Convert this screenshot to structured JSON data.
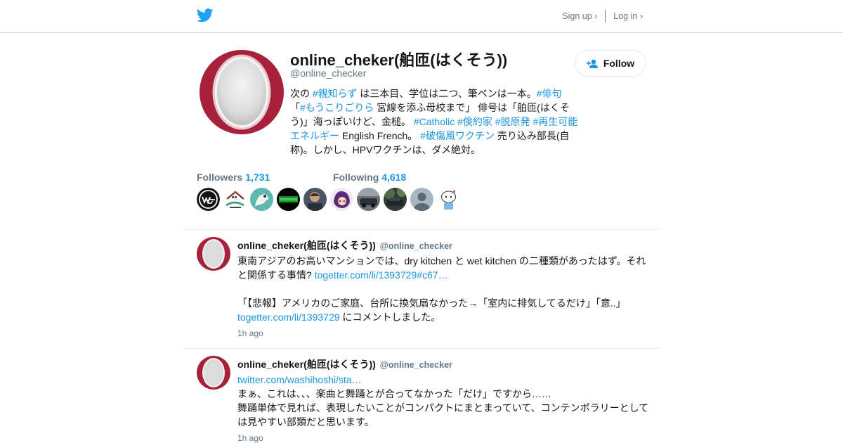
{
  "nav": {
    "signup_label": "Sign up ›",
    "login_label": "Log in ›"
  },
  "profile": {
    "name": "online_cheker(舶匝(はくそう))",
    "handle": "@online_checker",
    "follow_label": "Follow",
    "bio": {
      "s1": "次の ",
      "t1": "#親知らず",
      "s2": " は三本目、学位は二つ、筆ペンは一本。",
      "t2": "#俳句",
      "s3": "「",
      "t3": "#もうこりごりら",
      "s4": " 宮線を添ふ母校まで」 俳号は「舶匝(はくそう)」海っぽいけど、金槌。 ",
      "t4": "#Catholic",
      "s5": " ",
      "t5": "#倹約家",
      "s6": " ",
      "t6": "#脱原発",
      "s7": " ",
      "t7": "#再生可能エネルギー",
      "s8": " English French。 ",
      "t8": "#破傷風ワクチン",
      "s9": " 売り込み部長(自称)。しかし、HPVワクチンは、ダメ絶対。"
    },
    "followers_label": "Followers",
    "followers_count": "1,731",
    "following_label": "Following",
    "following_count": "4,618"
  },
  "tweets": [
    {
      "name": "online_cheker(舶匝(はくそう))",
      "handle": "@online_checker",
      "p1_text": "東南アジアのお高いマンションでは、dry kitchen と wet kitchen の二種類があったはず。それと関係する事情? ",
      "p1_link": "togetter.com/li/1393729#c67…",
      "p2_text": "「【悲報】アメリカのご家庭、台所に換気扇なかった→「室内に排気してるだけ」「意..」",
      "p3_link": "togetter.com/li/1393729",
      "p3_text": " にコメントしました。",
      "time": "1h ago"
    },
    {
      "name": "online_cheker(舶匝(はくそう))",
      "handle": "@online_checker",
      "p1_link": "twitter.com/washihoshi/sta…",
      "p2_text": "まぁ、これは、、、楽曲と舞踊とが合ってなかった「だけ」ですから……",
      "p3_text": "舞踊単体で見れば、表現したいことがコンパクトにまとまっていて、コンテンポラリーとしては見やすい部類だと思います。",
      "time": "1h ago"
    }
  ],
  "colors": {
    "link": "#1b95e0",
    "muted": "#657786",
    "avatar_ring": "#a8213a",
    "twitter_blue": "#1da1f2"
  },
  "icons": [
    "twitter-bird-icon",
    "add-user-icon"
  ]
}
